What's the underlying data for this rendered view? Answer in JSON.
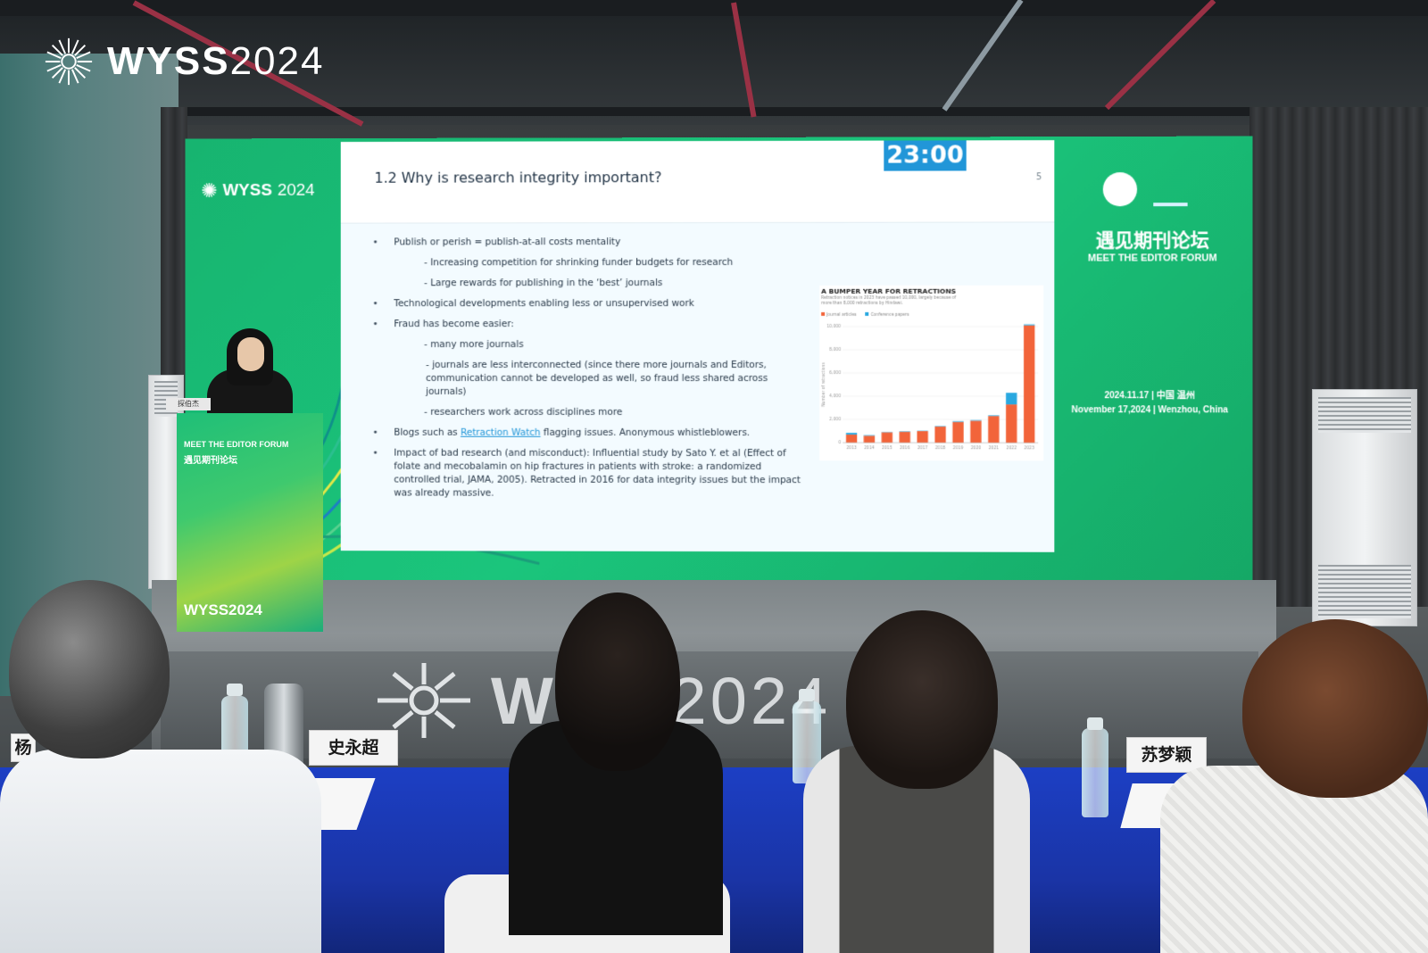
{
  "watermark": {
    "brand": "WYSS",
    "year": "2024"
  },
  "screen": {
    "logo_brand": "WYSS",
    "logo_year": "2024",
    "forum_cn": "遇见期刊论坛",
    "forum_en": "MEET THE EDITOR FORUM",
    "date_line1": "2024.11.17 | 中国 温州",
    "date_line2": "November 17,2024 | Wenzhou, China"
  },
  "slide": {
    "title": "1.2 Why is research integrity important?",
    "page": "5",
    "timer": "23:00",
    "b1": "Publish or perish = publish-at-all costs mentality",
    "b1_s1": "- Increasing competition for shrinking funder budgets for research",
    "b1_s2": "- Large rewards for publishing in the ‘best’ journals",
    "b2": "Technological developments enabling less or unsupervised work",
    "b3": "Fraud has become easier:",
    "b3_s1": "- many more journals",
    "b3_s2": "- journals are less interconnected (since there more journals and Editors, communication cannot be developed as well, so fraud less shared across journals)",
    "b3_s3": "- researchers work across disciplines more",
    "b4_pre": "Blogs such as ",
    "b4_link": "Retraction Watch",
    "b4_post": " flagging issues. Anonymous whistleblowers.",
    "b5": "Impact of bad research (and misconduct): Influential study by Sato Y. et al (Effect of folate and mecobalamin on hip fractures in patients with stroke: a randomized controlled trial, JAMA, 2005). Retracted in 2016 for data integrity issues but the impact was already massive."
  },
  "chart_data": {
    "type": "bar",
    "title": "A BUMPER YEAR FOR RETRACTIONS",
    "subtitle": "Retraction notices in 2023 have passed 10,000, largely because of more than 8,000 retractions by Hindawi.",
    "categories": [
      "2013",
      "2014",
      "2015",
      "2016",
      "2017",
      "2018",
      "2019",
      "2020",
      "2021",
      "2022",
      "2023"
    ],
    "series": [
      {
        "name": "Journal articles",
        "color": "#f2643a",
        "values": [
          700,
          600,
          900,
          950,
          1000,
          1400,
          1800,
          1900,
          2300,
          3300,
          10100
        ]
      },
      {
        "name": "Conference papers",
        "color": "#29a8e0",
        "values": [
          150,
          50,
          30,
          40,
          30,
          40,
          60,
          50,
          60,
          1000,
          80
        ]
      }
    ],
    "ylim": [
      0,
      10000
    ],
    "yticks": [
      "0",
      "2,000",
      "4,000",
      "6,000",
      "8,000",
      "10,000"
    ],
    "ylabel": "Number of retractions"
  },
  "podium": {
    "title": "MEET THE EDITOR FORUM",
    "cn": "遇见期刊论坛",
    "logo": "WYSS2024",
    "speaker_nameplate": "探伯杰"
  },
  "stage_logo": {
    "brand": "WY",
    "year": "S2024"
  },
  "nameplates": {
    "left_cut": "杨",
    "middle": "史永超",
    "right": "苏梦颖"
  }
}
